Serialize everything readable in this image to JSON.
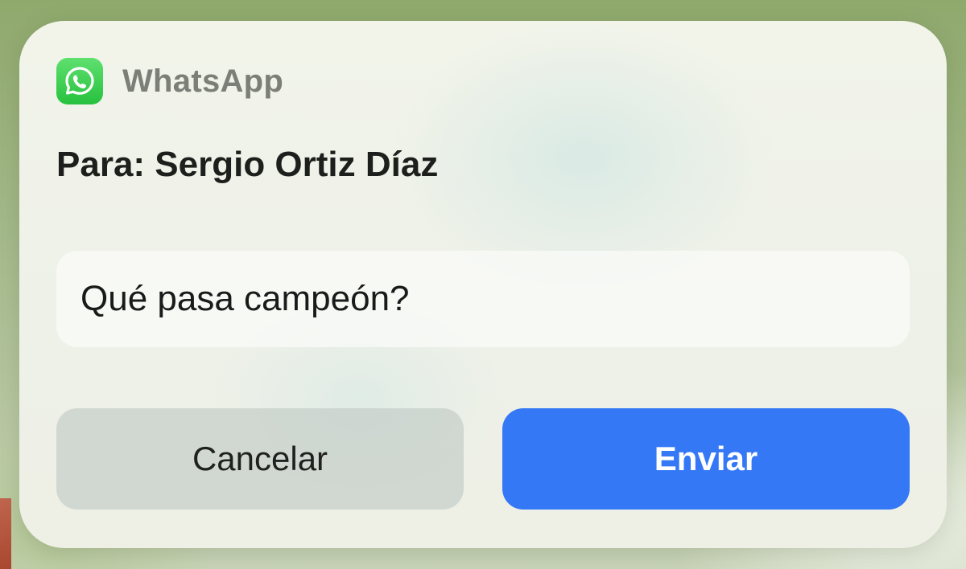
{
  "notification": {
    "app_name": "WhatsApp",
    "app_icon": "whatsapp-icon",
    "recipient": "Para: Sergio Ortiz Díaz",
    "message": "Qué pasa campeón?",
    "cancel_label": "Cancelar",
    "send_label": "Enviar"
  },
  "colors": {
    "accent": "#3478f6",
    "whatsapp_green": "#27c13e",
    "cancel_bg": "#c4cdc8"
  }
}
